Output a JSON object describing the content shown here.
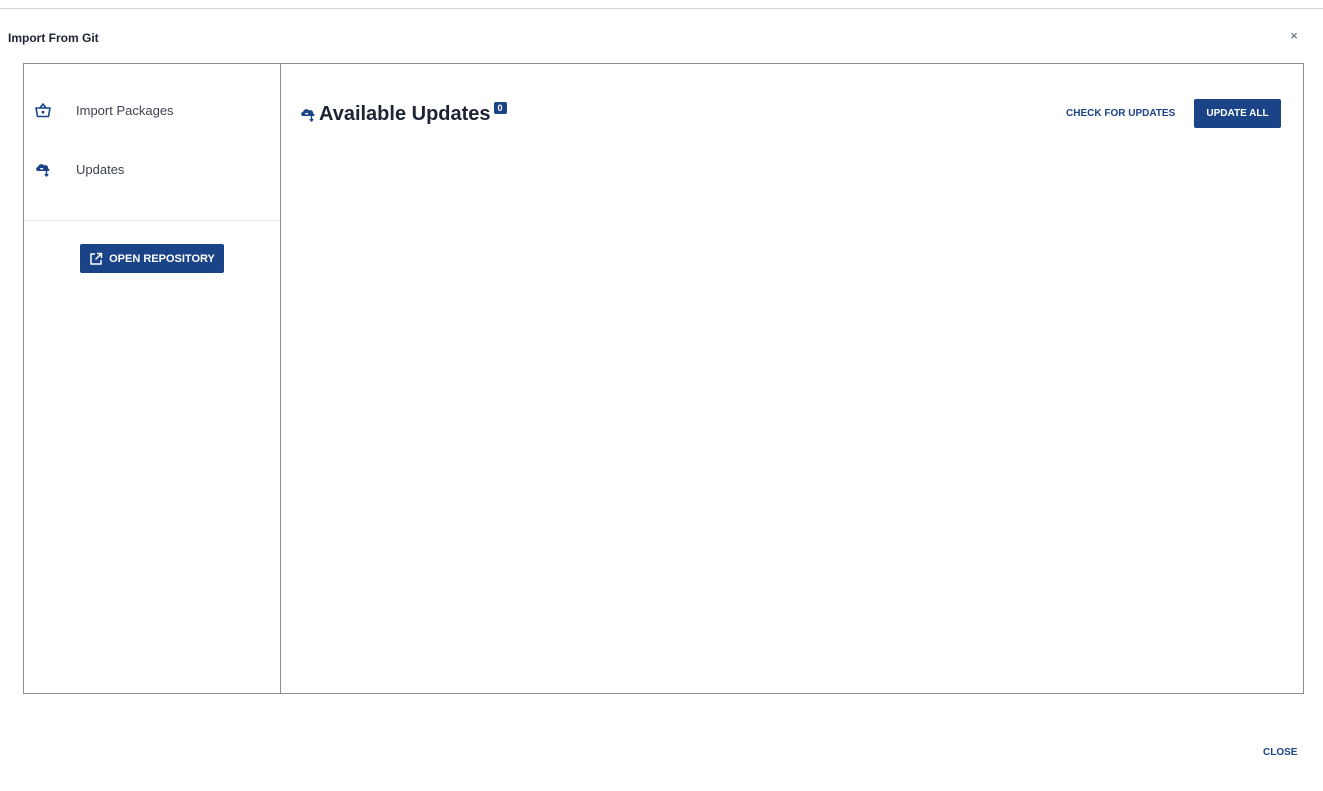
{
  "dialog": {
    "title": "Import From Git",
    "close_glyph": "×"
  },
  "sidebar": {
    "items": [
      {
        "label": "Import Packages",
        "icon": "basket-icon"
      },
      {
        "label": "Updates",
        "icon": "cloud-download-icon"
      }
    ],
    "open_repository_label": "OPEN REPOSITORY"
  },
  "main": {
    "title": "Available Updates",
    "count": "0",
    "check_updates_label": "CHECK FOR UPDATES",
    "update_all_label": "UPDATE ALL"
  },
  "footer": {
    "close_label": "CLOSE"
  },
  "colors": {
    "accent": "#1a4388",
    "border": "#8a8f98"
  }
}
